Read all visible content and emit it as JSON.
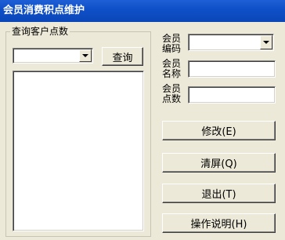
{
  "window": {
    "title": "会员消费积点维护"
  },
  "query_group": {
    "title": "查询客户点数",
    "customer_select_value": "",
    "query_button": "查询"
  },
  "fields": {
    "member_id_label": "会员编码",
    "member_name_label": "会员名称",
    "member_points_label": "会员点数",
    "member_id_value": "",
    "member_name_value": "",
    "member_points_value": ""
  },
  "buttons": {
    "modify": "修改(E)",
    "clear": "清屏(Q)",
    "exit": "退出(T)",
    "help": "操作说明(H)"
  }
}
